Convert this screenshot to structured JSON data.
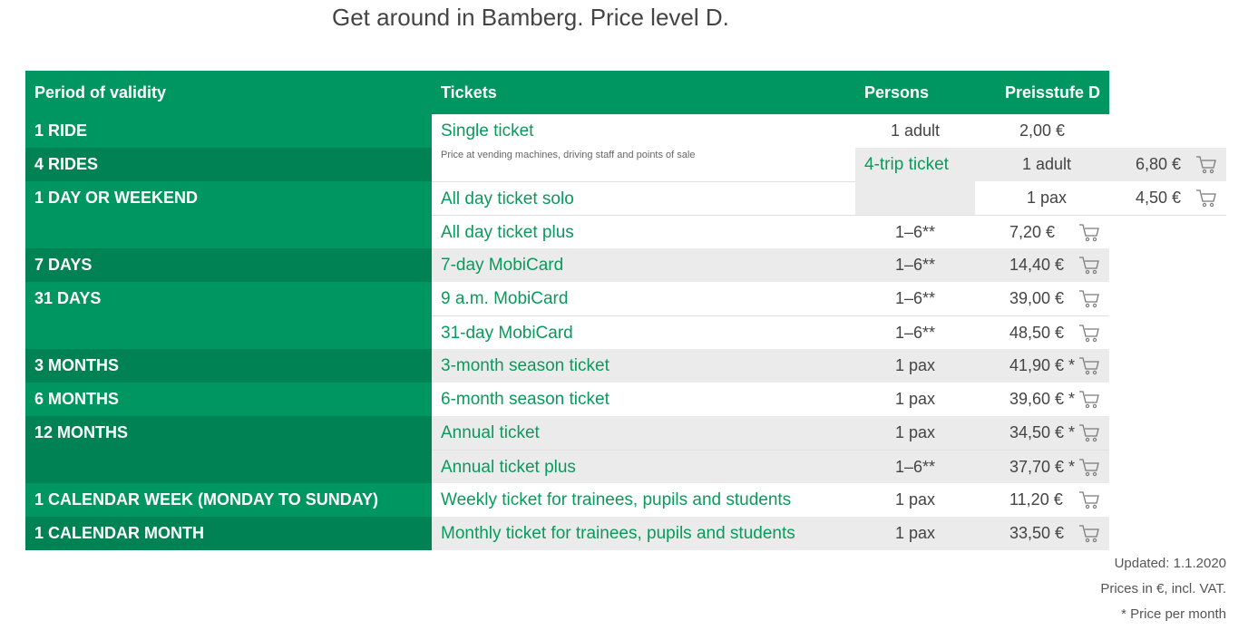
{
  "title": "Get around in Bamberg. Price level D.",
  "header": {
    "period": "Period of validity",
    "tickets": "Tickets",
    "persons": "Persons",
    "price": "Preisstufe D"
  },
  "periods": {
    "ride1": "1 RIDE",
    "rides4": "4 RIDES",
    "day": "1 DAY OR WEEKEND",
    "days7": "7 DAYS",
    "days31": "31 DAYS",
    "months3": "3 MONTHS",
    "months6": "6 MONTHS",
    "months12": "12 MONTHS",
    "cal_week": "1 CALENDAR WEEK (MONDAY TO SUNDAY)",
    "cal_month": "1 CALENDAR MONTH"
  },
  "tickets": [
    {
      "name": "Single ticket",
      "persons": "1 adult",
      "price": "2,00 €",
      "note": "Price at vending machines, driving staff and points of sale"
    },
    {
      "name": "4-trip ticket",
      "persons": "1 adult",
      "price": "6,80 €"
    },
    {
      "name": "All day ticket solo",
      "persons": "1 pax",
      "price": "4,50 €"
    },
    {
      "name": "All day ticket plus",
      "persons": "1–6**",
      "price": "7,20 €"
    },
    {
      "name": "7-day MobiCard",
      "persons": "1–6**",
      "price": "14,40 €"
    },
    {
      "name": "9 a.m. MobiCard",
      "persons": "1–6**",
      "price": "39,00 €"
    },
    {
      "name": "31-day MobiCard",
      "persons": "1–6**",
      "price": "48,50 €"
    },
    {
      "name": "3-month season ticket",
      "persons": "1 pax",
      "price": "41,90 € *"
    },
    {
      "name": "6-month season ticket",
      "persons": "1 pax",
      "price": "39,60 € *"
    },
    {
      "name": "Annual ticket",
      "persons": "1 pax",
      "price": "34,50 € *"
    },
    {
      "name": "Annual ticket plus",
      "persons": "1–6**",
      "price": "37,70 € *"
    },
    {
      "name": "Weekly ticket for trainees, pupils and students",
      "persons": "1 pax",
      "price": "11,20 €"
    },
    {
      "name": "Monthly ticket for trainees, pupils and students",
      "persons": "1 pax",
      "price": "33,50 €"
    }
  ],
  "footer": {
    "updated": "Updated: 1.1.2020",
    "prices": "Prices in €, incl. VAT.",
    "per_month": "* Price per month"
  },
  "colors": {
    "green": "#009661",
    "dark_green": "#008255",
    "ticket_link": "#0a9a5c",
    "row_gray": "#ebebeb"
  },
  "icons": {
    "cart": "shopping-cart-icon"
  }
}
